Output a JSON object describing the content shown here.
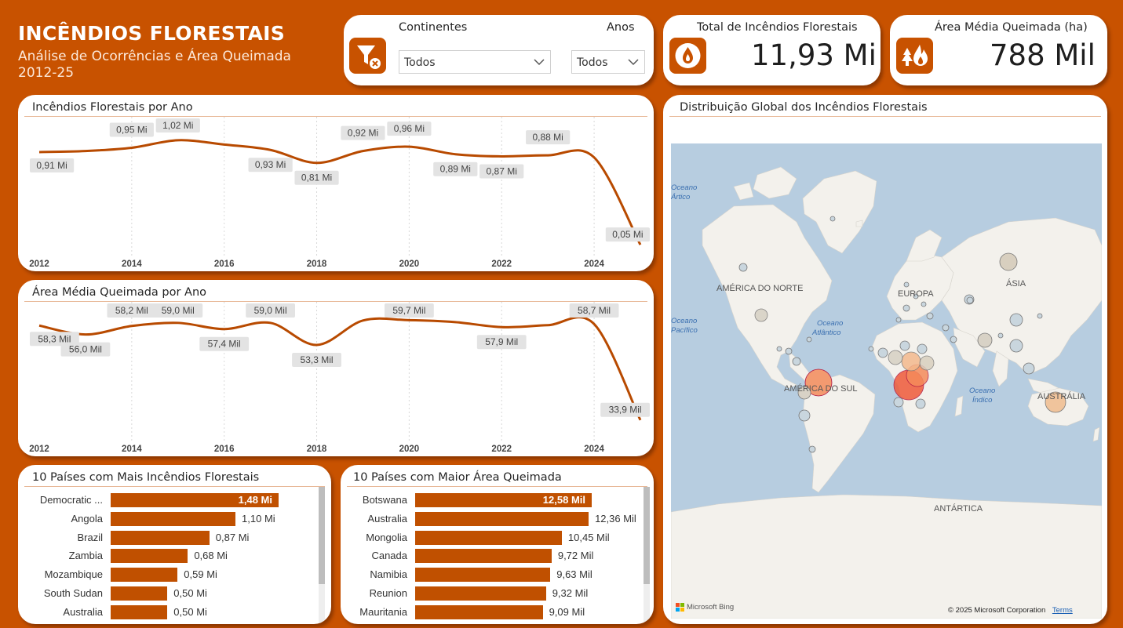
{
  "header": {
    "title": "INCÊNDIOS FLORESTAIS",
    "subtitle": "Análise de Ocorrências e Área Queimada 2012-25"
  },
  "filters": {
    "continents_label": "Continentes",
    "continents_value": "Todos",
    "years_label": "Anos",
    "years_value": "Todos"
  },
  "kpis": {
    "total_label": "Total de Incêndios Florestais",
    "total_value": "11,93 Mi",
    "area_label": "Área Média Queimada (ha)",
    "area_value": "788 Mil"
  },
  "fires_by_year": {
    "title": "Incêndios Florestais por Ano",
    "x_ticks": [
      "2012",
      "2014",
      "2016",
      "2018",
      "2020",
      "2022",
      "2024"
    ],
    "chart_data": {
      "type": "line",
      "x": [
        2012,
        2013,
        2014,
        2015,
        2016,
        2017,
        2018,
        2019,
        2020,
        2021,
        2022,
        2023,
        2024,
        2025
      ],
      "values": [
        0.91,
        0.92,
        0.95,
        1.02,
        0.98,
        0.93,
        0.81,
        0.92,
        0.96,
        0.89,
        0.87,
        0.88,
        0.86,
        0.05
      ],
      "labels": [
        "0,91 Mi",
        null,
        "0,95 Mi",
        "1,02 Mi",
        null,
        "0,93 Mi",
        "0,81 Mi",
        "0,92 Mi",
        "0,96 Mi",
        "0,89 Mi",
        "0,87 Mi",
        "0,88 Mi",
        null,
        "0,05 Mi"
      ],
      "xlim": [
        2012,
        2025
      ],
      "ylim": [
        0,
        1.15
      ]
    }
  },
  "area_by_year": {
    "title": "Área Média Queimada por Ano",
    "x_ticks": [
      "2012",
      "2014",
      "2016",
      "2018",
      "2020",
      "2022",
      "2024"
    ],
    "chart_data": {
      "type": "line",
      "x": [
        2012,
        2013,
        2014,
        2015,
        2016,
        2017,
        2018,
        2019,
        2020,
        2021,
        2022,
        2023,
        2024,
        2025
      ],
      "values": [
        58.3,
        56.0,
        58.2,
        59.0,
        57.4,
        59.0,
        53.3,
        59.6,
        59.7,
        59.2,
        57.9,
        58.4,
        58.7,
        33.9
      ],
      "labels": [
        "58,3 Mil",
        "56,0 Mil",
        "58,2 Mil",
        "59,0 Mil",
        "57,4 Mil",
        "59,0 Mil",
        "53,3 Mil",
        null,
        "59,7 Mil",
        null,
        "57,9 Mil",
        null,
        "58,7 Mil",
        "33,9 Mil"
      ],
      "xlim": [
        2012,
        2025
      ],
      "ylim": [
        30,
        62
      ]
    }
  },
  "top_fires": {
    "title": "10 Países com Mais Incêndios Florestais",
    "chart_data": {
      "type": "bar",
      "categories": [
        "Democratic ...",
        "Angola",
        "Brazil",
        "Zambia",
        "Mozambique",
        "South Sudan",
        "Australia"
      ],
      "values": [
        1.48,
        1.1,
        0.87,
        0.68,
        0.59,
        0.5,
        0.5
      ],
      "labels": [
        "1,48 Mi",
        "1,10 Mi",
        "0,87 Mi",
        "0,68 Mi",
        "0,59 Mi",
        "0,50 Mi",
        "0,50 Mi"
      ]
    }
  },
  "top_area": {
    "title": "10 Países com Maior Área Queimada",
    "chart_data": {
      "type": "bar",
      "categories": [
        "Botswana",
        "Australia",
        "Mongolia",
        "Canada",
        "Namibia",
        "Reunion",
        "Mauritania"
      ],
      "values": [
        12.58,
        12.36,
        10.45,
        9.72,
        9.63,
        9.32,
        9.09
      ],
      "labels": [
        "12,58 Mil",
        "12,36 Mil",
        "10,45 Mil",
        "9,72 Mil",
        "9,63 Mil",
        "9,32 Mil",
        "9,09 Mil"
      ]
    }
  },
  "map": {
    "title": "Distribuição Global dos Incêndios Florestais",
    "labels": {
      "north_america": "AMÉRICA DO NORTE",
      "south_america": "AMÉRICA DO SUL",
      "europe": "EUROPA",
      "asia": "ÁSIA",
      "australia": "AUSTRÁLIA",
      "antarctica": "ANTÁRTICA",
      "arctic_ocean_1": "Oceano",
      "arctic_ocean_2": "Ártico",
      "pacific_ocean_1": "Oceano",
      "pacific_ocean_2": "Pacífico",
      "atlantic_ocean_1": "Oceano",
      "atlantic_ocean_2": "Atlântico",
      "indian_ocean_1": "Oceano",
      "indian_ocean_2": "Índico"
    },
    "bing_logo": "Microsoft Bing",
    "copyright": "© 2025 Microsoft Corporation",
    "terms": "Terms",
    "colors": {
      "ocean": "#b7cde0",
      "land": "#f3f1ec",
      "bubble_low": "#a9c1cc",
      "bubble_high": "#f0623a"
    }
  },
  "colors": {
    "brand": "#c85200",
    "bar": "#c05000",
    "line": "#b84a00"
  }
}
